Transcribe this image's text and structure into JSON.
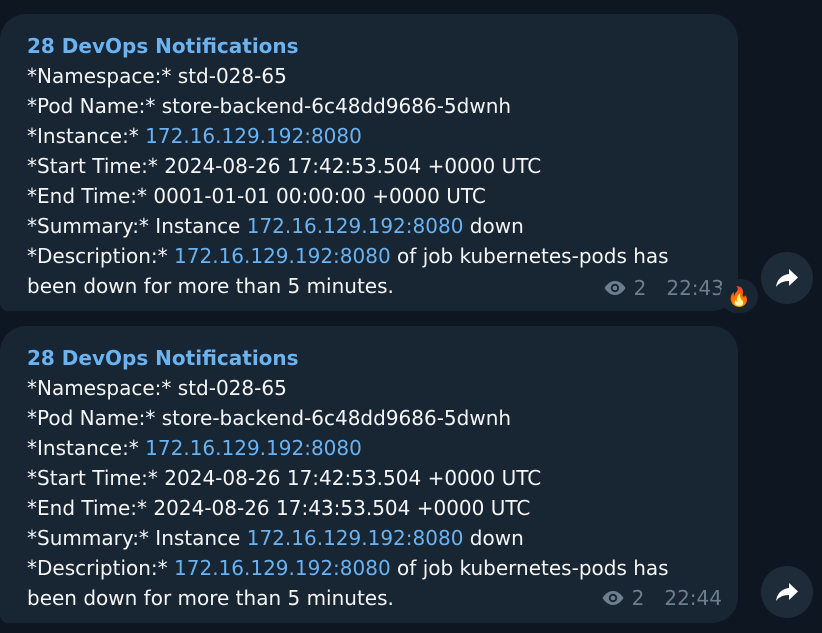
{
  "messages": [
    {
      "sender": "28 DevOps Notifications",
      "lines": {
        "namespace_label": "*Namespace:*",
        "namespace_value": " std-028-65",
        "pod_label": "*Pod Name:*",
        "pod_value": " store-backend-6c48dd9686-5dwnh",
        "instance_label": "*Instance:*",
        "instance_value": "172.16.129.192:8080",
        "start_label": "*Start Time:*",
        "start_value": " 2024-08-26 17:42:53.504 +0000 UTC",
        "end_label": "*End Time:*",
        "end_value": " 0001-01-01 00:00:00 +0000 UTC",
        "summary_label": "*Summary:*",
        "summary_pre": " Instance ",
        "summary_link": "172.16.129.192:8080",
        "summary_post": " down",
        "description_label": "*Description:*",
        "description_link": "172.16.129.192:8080",
        "description_post": " of job kubernetes-pods has been down for more than 5 minutes."
      },
      "views": "2",
      "time": "22:43",
      "reaction": "🔥"
    },
    {
      "sender": "28 DevOps Notifications",
      "lines": {
        "namespace_label": "*Namespace:*",
        "namespace_value": " std-028-65",
        "pod_label": "*Pod Name:*",
        "pod_value": " store-backend-6c48dd9686-5dwnh",
        "instance_label": "*Instance:*",
        "instance_value": "172.16.129.192:8080",
        "start_label": "*Start Time:*",
        "start_value": " 2024-08-26 17:42:53.504 +0000 UTC",
        "end_label": "*End Time:*",
        "end_value": " 2024-08-26 17:43:53.504 +0000 UTC",
        "summary_label": "*Summary:*",
        "summary_pre": " Instance ",
        "summary_link": "172.16.129.192:8080",
        "summary_post": " down",
        "description_label": "*Description:*",
        "description_link": "172.16.129.192:8080",
        "description_post": " of job kubernetes-pods has been down for more than 5 minutes."
      },
      "views": "2",
      "time": "22:44"
    }
  ],
  "colors": {
    "background": "#0e1621",
    "bubble": "#182533",
    "link": "#6ab3f3",
    "meta": "#6d7f8f"
  },
  "icons": {
    "views": "eye-icon",
    "forward": "forward-arrow-icon"
  }
}
